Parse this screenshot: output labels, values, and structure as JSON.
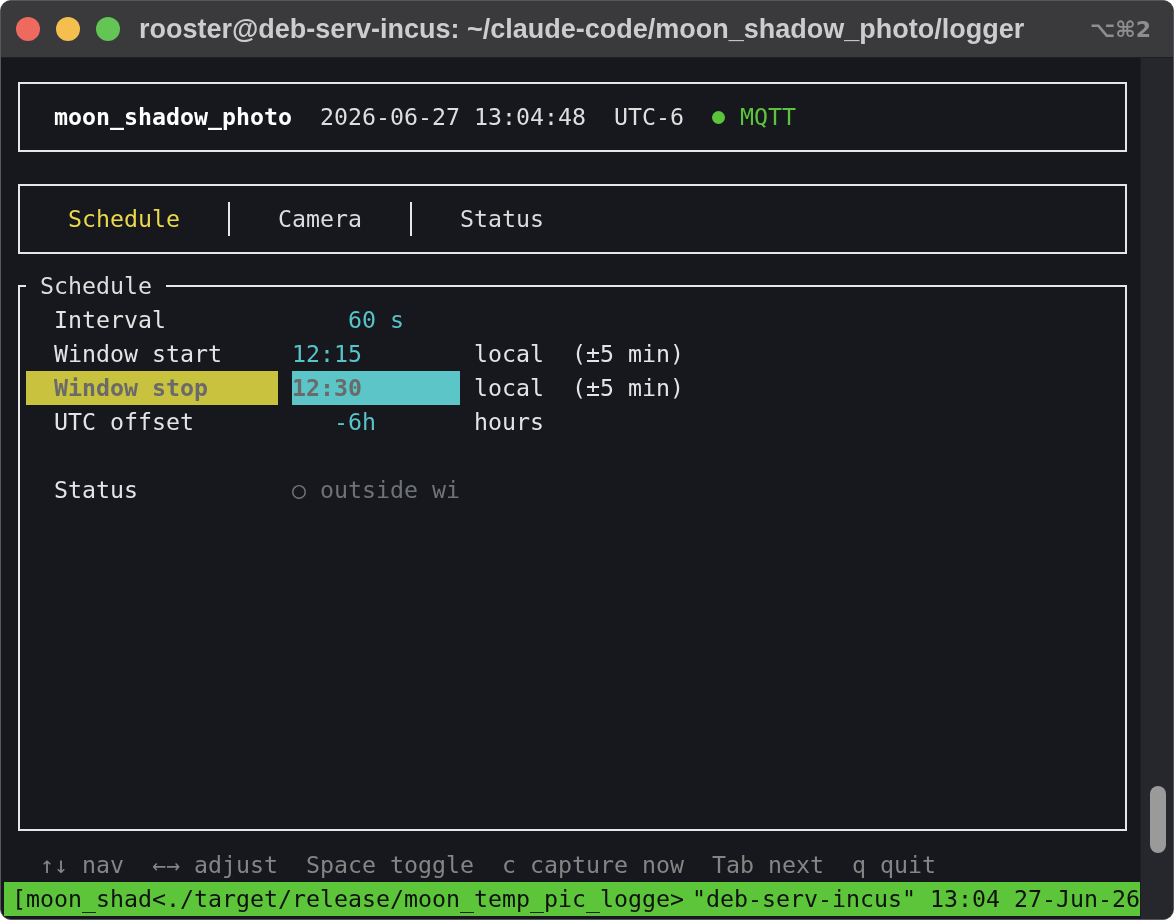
{
  "window": {
    "title": "rooster@deb-serv-incus: ~/claude-code/moon_shadow_photo/logger",
    "shortcut": "⌥⌘2"
  },
  "header": {
    "app_name": "moon_shadow_photo",
    "datetime": "2026-06-27 13:04:48",
    "timezone": "UTC-6",
    "connection": {
      "label": "MQTT",
      "connected": true
    }
  },
  "tabs": [
    {
      "label": "Schedule",
      "selected": true
    },
    {
      "label": "Camera",
      "selected": false
    },
    {
      "label": "Status",
      "selected": false
    }
  ],
  "panel": {
    "title": "Schedule",
    "rows": [
      {
        "kind": "duration",
        "label": "Interval",
        "value": "60 s",
        "selected": false
      },
      {
        "kind": "time",
        "label": "Window start",
        "value": "12:15",
        "unit": "local",
        "note": "(±5 min)",
        "selected": false
      },
      {
        "kind": "time",
        "label": "Window stop",
        "value": "12:30",
        "unit": "local",
        "note": "(±5 min)",
        "selected": true
      },
      {
        "kind": "offset",
        "label": "UTC offset",
        "value": "-6h",
        "unit": "hours",
        "selected": false
      }
    ],
    "status": {
      "label": "Status",
      "value": "○ outside wi"
    }
  },
  "help": [
    "↑↓ nav",
    "←→ adjust",
    "Space toggle",
    "c capture now",
    "Tab next",
    "q quit"
  ],
  "status_bar": {
    "left": "[moon_shad<./target/release/moon_temp_pic_logge>",
    "right": "\"deb-serv-incus\" 13:04 27-Jun-26"
  }
}
